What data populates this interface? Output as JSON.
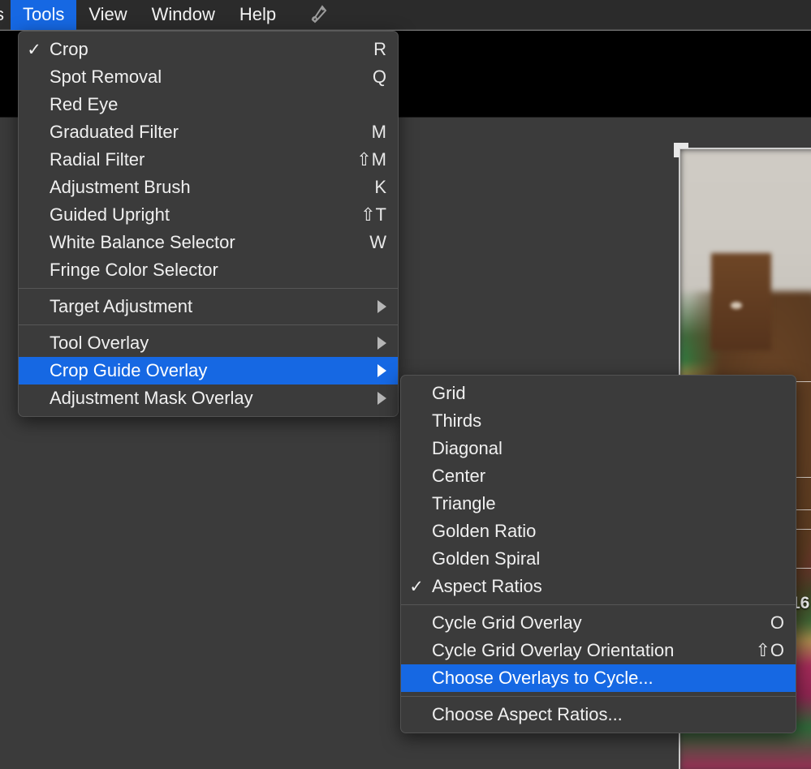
{
  "app": {
    "background_color": "#3b3b3b",
    "accent_color": "#1668e3",
    "menu_background": "#3b3b3b",
    "toolbar_color": "#000000"
  },
  "menubar": {
    "clipped_left_label": "s",
    "items": [
      {
        "label": "Tools",
        "active": true
      },
      {
        "label": "View",
        "active": false
      },
      {
        "label": "Window",
        "active": false
      },
      {
        "label": "Help",
        "active": false
      }
    ],
    "status_icon": "app-status-icon"
  },
  "tools_menu": {
    "title": "Tools",
    "groups": [
      {
        "items": [
          {
            "label": "Crop",
            "shortcut": "R",
            "checked": true,
            "submenu": false,
            "selected": false
          },
          {
            "label": "Spot Removal",
            "shortcut": "Q",
            "checked": false,
            "submenu": false,
            "selected": false
          },
          {
            "label": "Red Eye",
            "shortcut": "",
            "checked": false,
            "submenu": false,
            "selected": false
          },
          {
            "label": "Graduated Filter",
            "shortcut": "M",
            "checked": false,
            "submenu": false,
            "selected": false
          },
          {
            "label": "Radial Filter",
            "shortcut": "⇧M",
            "checked": false,
            "submenu": false,
            "selected": false
          },
          {
            "label": "Adjustment Brush",
            "shortcut": "K",
            "checked": false,
            "submenu": false,
            "selected": false
          },
          {
            "label": "Guided Upright",
            "shortcut": "⇧T",
            "checked": false,
            "submenu": false,
            "selected": false
          },
          {
            "label": "White Balance Selector",
            "shortcut": "W",
            "checked": false,
            "submenu": false,
            "selected": false
          },
          {
            "label": "Fringe Color Selector",
            "shortcut": "",
            "checked": false,
            "submenu": false,
            "selected": false
          }
        ]
      },
      {
        "items": [
          {
            "label": "Target Adjustment",
            "shortcut": "",
            "checked": false,
            "submenu": true,
            "selected": false
          }
        ]
      },
      {
        "items": [
          {
            "label": "Tool Overlay",
            "shortcut": "",
            "checked": false,
            "submenu": true,
            "selected": false
          },
          {
            "label": "Crop Guide Overlay",
            "shortcut": "",
            "checked": false,
            "submenu": true,
            "selected": true
          },
          {
            "label": "Adjustment Mask Overlay",
            "shortcut": "",
            "checked": false,
            "submenu": true,
            "selected": false
          }
        ]
      }
    ]
  },
  "crop_guide_submenu": {
    "title": "Crop Guide Overlay",
    "groups": [
      {
        "items": [
          {
            "label": "Grid",
            "shortcut": "",
            "checked": false,
            "selected": false
          },
          {
            "label": "Thirds",
            "shortcut": "",
            "checked": false,
            "selected": false
          },
          {
            "label": "Diagonal",
            "shortcut": "",
            "checked": false,
            "selected": false
          },
          {
            "label": "Center",
            "shortcut": "",
            "checked": false,
            "selected": false
          },
          {
            "label": "Triangle",
            "shortcut": "",
            "checked": false,
            "selected": false
          },
          {
            "label": "Golden Ratio",
            "shortcut": "",
            "checked": false,
            "selected": false
          },
          {
            "label": "Golden Spiral",
            "shortcut": "",
            "checked": false,
            "selected": false
          },
          {
            "label": "Aspect Ratios",
            "shortcut": "",
            "checked": true,
            "selected": false
          }
        ]
      },
      {
        "items": [
          {
            "label": "Cycle Grid Overlay",
            "shortcut": "O",
            "checked": false,
            "selected": false
          },
          {
            "label": "Cycle Grid Overlay Orientation",
            "shortcut": "⇧O",
            "checked": false,
            "selected": false
          },
          {
            "label": "Choose Overlays to Cycle...",
            "shortcut": "",
            "checked": false,
            "selected": true
          }
        ]
      },
      {
        "items": [
          {
            "label": "Choose Aspect Ratios...",
            "shortcut": "",
            "checked": false,
            "selected": false
          }
        ]
      }
    ]
  },
  "canvas": {
    "photo_description": "blurred photo of a wall, wooden door and zigzag striped blanket",
    "crop_overlay": {
      "handle": "crop-corner-handle",
      "aspect_ratio_label": "16",
      "guide_lines": [
        470,
        588,
        628,
        652,
        700
      ]
    }
  },
  "glyphs": {
    "check": "✓",
    "shift": "⇧"
  }
}
